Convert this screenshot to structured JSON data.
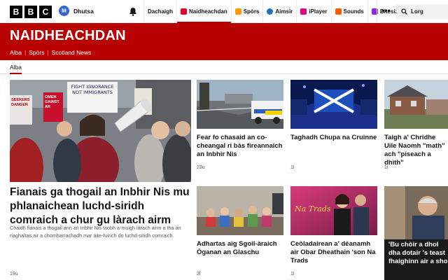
{
  "topnav": {
    "logo_letters": [
      "B",
      "B",
      "C"
    ],
    "account_initial": "M",
    "account_name": "Dhutsa",
    "links": [
      {
        "label": "Dachaigh",
        "icon": "home",
        "color": ""
      },
      {
        "label": "Naidheachdan",
        "icon": "news-icon",
        "color": "#e4002b",
        "active": true
      },
      {
        "label": "Spòrs",
        "icon": "sport-icon",
        "color": "#ff7a00"
      },
      {
        "label": "Aimsir",
        "icon": "weather-icon",
        "color": "#1e73be"
      },
      {
        "label": "iPlayer",
        "icon": "iplayer-icon",
        "color": "#e6007e"
      },
      {
        "label": "Sounds",
        "icon": "sounds-icon",
        "color": "#ff5a00"
      },
      {
        "label": "Bitesize",
        "icon": "bitesize-icon",
        "color": "#8a2be2"
      }
    ],
    "more": "•••",
    "search_label": "Lorg"
  },
  "header": {
    "title": "NAIDHEACHDAN",
    "subnav": [
      "Alba",
      "Spòrs",
      "Scotland News"
    ],
    "section_tab": "Alba"
  },
  "lead": {
    "title": "Fianais ga thogail an Inbhir Nis mu phlanaichean luchd-siridh comraich a chur gu làrach airm",
    "summary": "Chaidh fianais a thogail ann an Inbhir Nis taobh a-muigh làrach airm a tha an riaghaltas air a chomharrachadh mar àite-fuirich do luchd-siridh comraich.",
    "time": "19u",
    "signs": [
      "FIGHT IGNORANCE NOT IMMIGRANTS",
      "SEEKERS DANGER",
      "OMEN GAINST AR"
    ]
  },
  "cards": [
    {
      "title": "Fear fo chasaid an co-cheangal ri bàs fireannaich an Inbhir Nis",
      "time": "23u"
    },
    {
      "title": "Taghadh Chupa na Cruinne",
      "time": "1l"
    },
    {
      "title": "Taigh a' Chridhe Uile Naomh \"math\" ach \"piseach a dhìth\"",
      "time": "1l"
    },
    {
      "title": "Adhartas aig Sgoil-àraich Òganan an Glaschu",
      "time": "2l"
    },
    {
      "title": "Ceòladairean a' dèanamh air Obar Dheathain 'son Na Trads",
      "time": "1l",
      "overlay": "Na Trads"
    },
    {
      "title": "'Bu chòir a dhol dha dotair 's teast fhaighinn air a sho",
      "time": ""
    }
  ]
}
